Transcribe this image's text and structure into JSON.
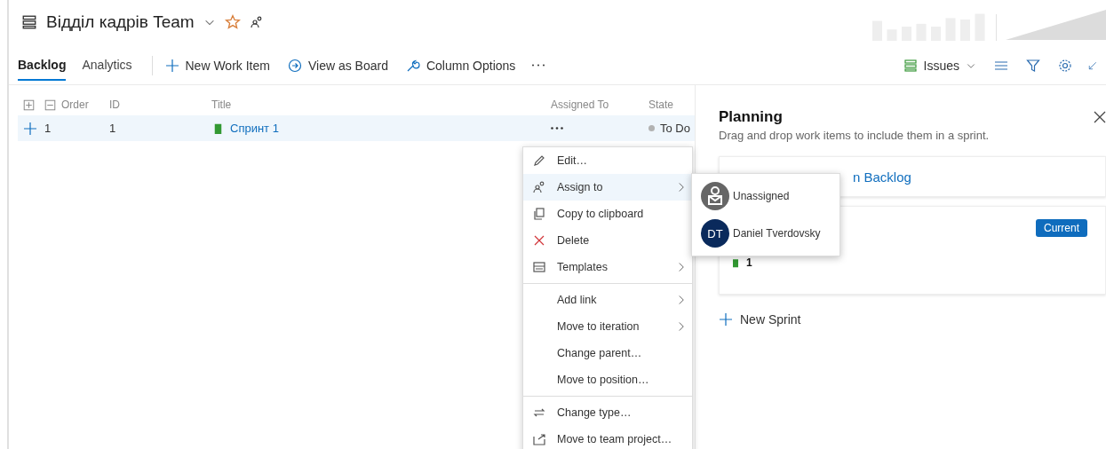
{
  "header": {
    "title": "Відділ кадрів Team"
  },
  "tabs": [
    {
      "label": "Backlog",
      "selected": true
    },
    {
      "label": "Analytics",
      "selected": false
    }
  ],
  "toolbar": [
    {
      "label": "New Work Item",
      "kind": "plus"
    },
    {
      "label": "View as Board",
      "kind": "board"
    },
    {
      "label": "Column Options",
      "kind": "wrench"
    }
  ],
  "work_item_type_dropdown": {
    "label": "Issues"
  },
  "table": {
    "columns": [
      "Order",
      "ID",
      "Title",
      "Assigned To",
      "State"
    ],
    "rows": [
      {
        "order": "1",
        "id": "1",
        "title": "Спринт 1",
        "state": "To Do",
        "selected": true
      }
    ]
  },
  "context_menu": {
    "groups": [
      [
        {
          "label": "Edit…",
          "kind": "pencil",
          "submenu": false,
          "selected": false
        },
        {
          "label": "Assign to",
          "kind": "people",
          "submenu": true,
          "selected": true
        },
        {
          "label": "Copy to clipboard",
          "kind": "copy",
          "submenu": false,
          "selected": false
        },
        {
          "label": "Delete",
          "kind": "delete",
          "submenu": false,
          "selected": false
        },
        {
          "label": "Templates",
          "kind": "template",
          "submenu": true,
          "selected": false
        }
      ],
      [
        {
          "label": "Add link",
          "kind": "plain",
          "submenu": true,
          "selected": false
        },
        {
          "label": "Move to iteration",
          "kind": "plain",
          "submenu": true,
          "selected": false
        },
        {
          "label": "Change parent…",
          "kind": "plain",
          "submenu": false,
          "selected": false
        },
        {
          "label": "Move to position…",
          "kind": "plain",
          "submenu": false,
          "selected": false
        }
      ],
      [
        {
          "label": "Change type…",
          "kind": "swap",
          "submenu": false,
          "selected": false
        },
        {
          "label": "Move to team project…",
          "kind": "move",
          "submenu": false,
          "selected": false
        }
      ]
    ]
  },
  "assign_menu": [
    {
      "label": "Unassigned",
      "kind": "unassigned"
    },
    {
      "label": "Daniel Tverdovsky",
      "kind": "user",
      "initials": "DT"
    }
  ],
  "planning": {
    "title": "Planning",
    "subtitle": "Drag and drop work items to include them in a sprint.",
    "backlog_card": {
      "title": "n Backlog"
    },
    "sprint_card": {
      "badge": "Current",
      "item": "1"
    },
    "new_sprint": "New Sprint"
  }
}
